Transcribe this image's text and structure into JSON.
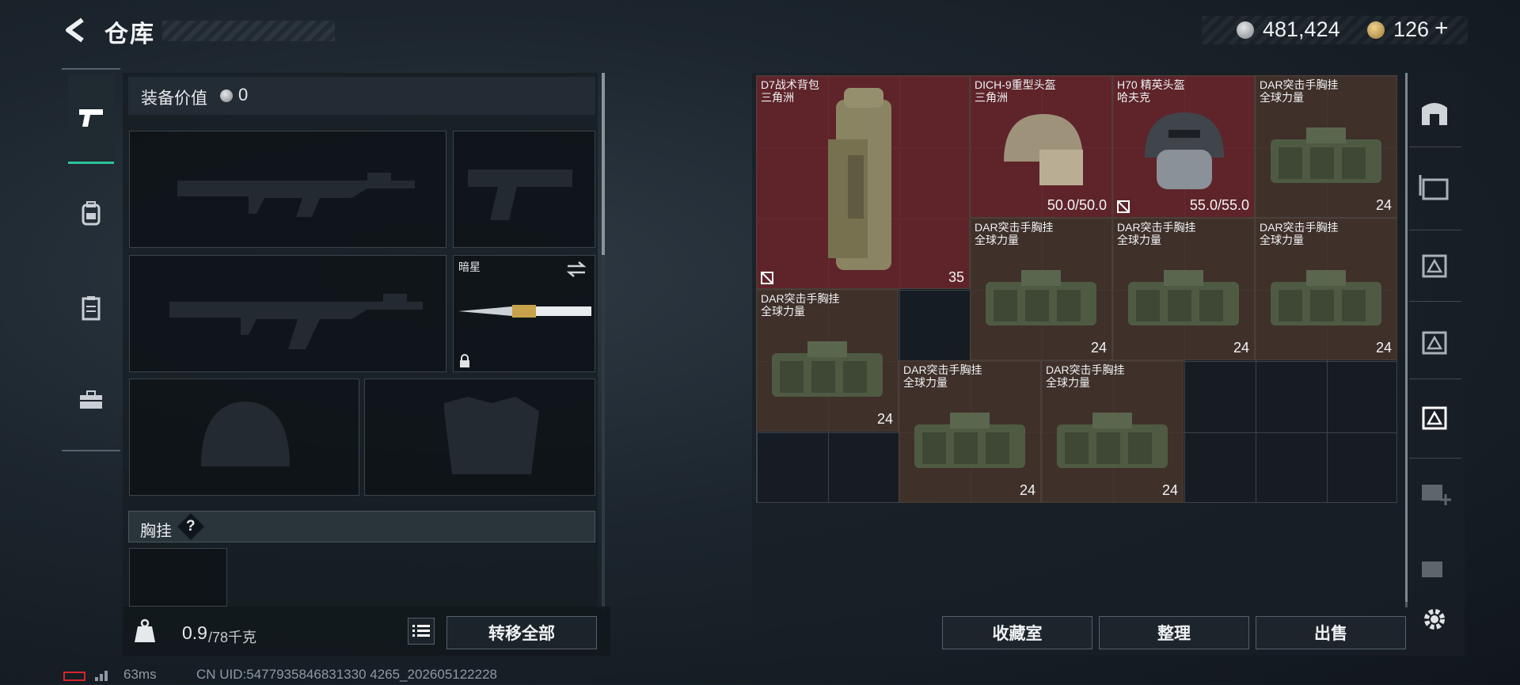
{
  "header": {
    "title": "仓库"
  },
  "currency": {
    "silver": "481,424",
    "gold": "126",
    "gold_plus": "+"
  },
  "equipment": {
    "value_label": "装备价值",
    "value": "0",
    "knife_label": "暗星",
    "section_label": "胸挂",
    "help": "?",
    "weight_current": "0.9",
    "weight_max": "/78千克",
    "transfer_all": "转移全部"
  },
  "inventory": {
    "items": [
      {
        "name": "D7战术背包",
        "sub": "三角洲",
        "val": "35"
      },
      {
        "name": "DICH-9重型头盔",
        "sub": "三角洲",
        "val": "50.0/50.0"
      },
      {
        "name": "H70 精英头盔",
        "sub": "哈夫克",
        "val": "55.0/55.0"
      },
      {
        "name": "DAR突击手胸挂",
        "sub": "全球力量",
        "val": "24"
      },
      {
        "name": "DAR突击手胸挂",
        "sub": "全球力量",
        "val": "24"
      },
      {
        "name": "DAR突击手胸挂",
        "sub": "全球力量",
        "val": "24"
      },
      {
        "name": "DAR突击手胸挂",
        "sub": "全球力量",
        "val": "24"
      },
      {
        "name": "DAR突击手胸挂",
        "sub": "全球力量",
        "val": "24"
      },
      {
        "name": "DAR突击手胸挂",
        "sub": "全球力量",
        "val": "24"
      },
      {
        "name": "DAR突击手胸挂",
        "sub": "全球力量",
        "val": "24"
      }
    ],
    "buttons": {
      "collection": "收藏室",
      "sort": "整理",
      "sell": "出售"
    }
  },
  "status": {
    "ping": "63ms",
    "uid": "CN UID:5477935846831330 4265_202605122228"
  },
  "icons": [
    "back-arrow-icon",
    "pistol-icon",
    "backpack-icon",
    "vest-icon",
    "toolbox-icon",
    "weight-icon",
    "list-icon",
    "swap-icon",
    "lock-icon",
    "settings-icon"
  ],
  "colors": {
    "accent": "#2fc49a",
    "rare_red": "#6e262c",
    "brown": "#463429"
  }
}
